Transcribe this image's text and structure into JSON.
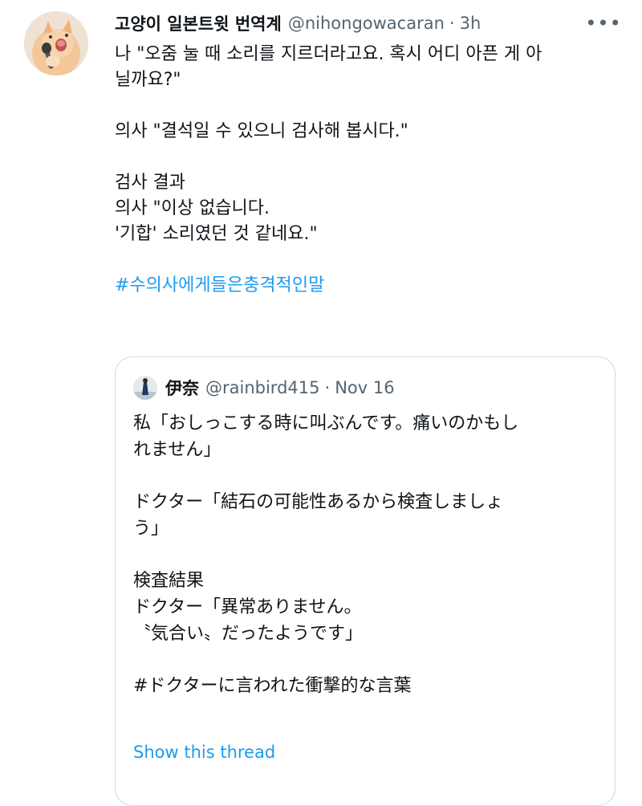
{
  "tweet": {
    "author": {
      "display_name": "고양이 일본트윗 번역계",
      "handle": "@nihongowacaran",
      "separator": "·",
      "time": "3h"
    },
    "more_icon": "more-icon",
    "lines": [
      "나 \"오줌 눌 때 소리를 지르더라고요. 혹시 어디 아픈 게 아",
      "닐까요?\"",
      "의사 \"결석일 수 있으니 검사해 봅시다.\"",
      "검사 결과",
      "의사 \"이상 없습니다.",
      "'기합' 소리였던 것 같네요.\""
    ],
    "hashtag": "#수의사에게들은충격적인말"
  },
  "quoted_tweet": {
    "author": {
      "display_name": "伊奈",
      "handle": "@rainbird415",
      "separator": "·",
      "time": "Nov 16"
    },
    "lines": [
      "私「おしっこする時に叫ぶんです。痛いのかもし",
      "れません」",
      "ドクター「結石の可能性あるから検査しましょ",
      "う」",
      "検査結果",
      "ドクター「異常ありません。",
      "〝気合い〟だったようです」",
      "#ドクターに言われた衝撃的な言葉"
    ],
    "show_thread": "Show this thread"
  },
  "colors": {
    "link": "#1d9bf0",
    "secondary_text": "#536471",
    "border": "#cfd9de"
  }
}
